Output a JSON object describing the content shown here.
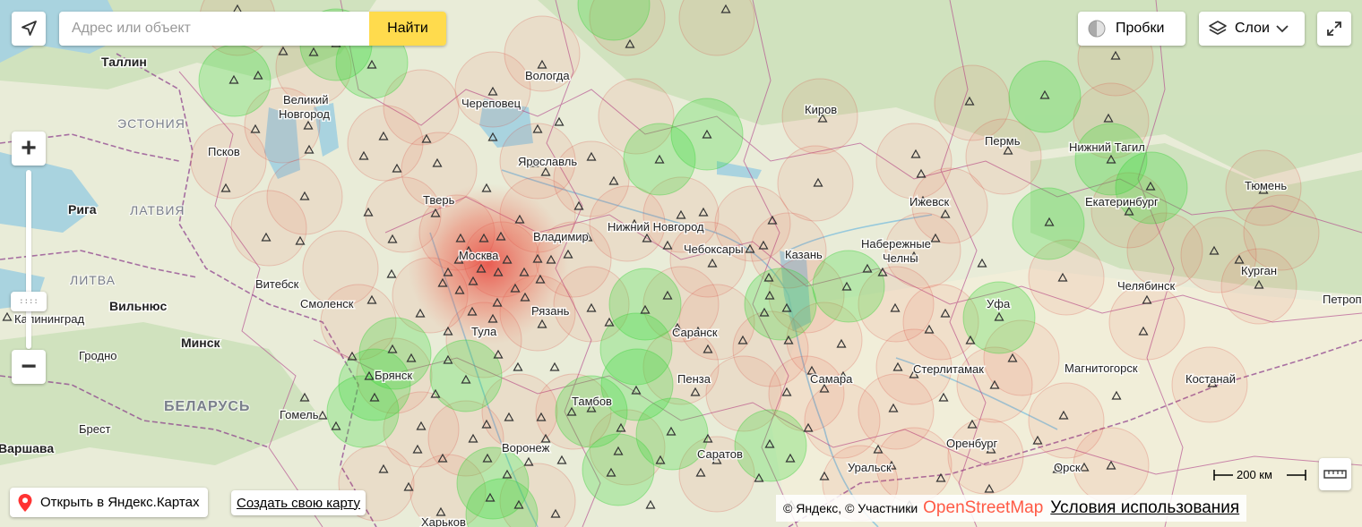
{
  "search": {
    "placeholder": "Адрес или объект",
    "button_label": "Найти"
  },
  "top_right": {
    "traffic_label": "Пробки",
    "layers_label": "Слои"
  },
  "bottom_left": {
    "open_in_maps": "Открыть в Яндекс.Картах",
    "create_map": "Создать свою карту"
  },
  "copyright": {
    "prefix": "© Яндекс, © Участники",
    "osm": "OpenStreetMap",
    "terms": "Условия использования"
  },
  "scale": {
    "label": "200 км"
  },
  "zoom": {
    "plus": "+",
    "minus": "−"
  },
  "colors": {
    "search_button": "#ffdb4d",
    "heat_red": "#e8412e",
    "heat_green": "#3bdc3b",
    "land": "#e9ecd8",
    "water": "#a9d3df",
    "forest": "#c7dfb6",
    "border_purple": "#b34b8e"
  },
  "map": {
    "cities": [
      "Таллин",
      "Великий Новгород",
      "Череповец",
      "Вологда",
      "Псков",
      "Ярославль",
      "Тверь",
      "Москва",
      "Владимир",
      "Нижний Новгород",
      "Чебоксары",
      "Казань",
      "Киров",
      "Пермь",
      "Нижний Тагил",
      "Екатеринбург",
      "Тюмень",
      "Ижевск",
      "Набережные Челны",
      "Рига",
      "Смоленск",
      "Витебск",
      "Вильнюс",
      "Калининград",
      "Минск",
      "Гродно",
      "Брянск",
      "Тула",
      "Рязань",
      "Саранск",
      "Уфа",
      "Челябинск",
      "Курган",
      "Петропавловск",
      "Гомель",
      "Брест",
      "Варшава",
      "Тамбов",
      "Пенза",
      "Самара",
      "Стерлитамак",
      "Магнитогорск",
      "Костанай",
      "Воронеж",
      "Саратов",
      "Оренбург",
      "Орск",
      "Уральск",
      "Харьков"
    ],
    "regions": [
      "ЭСТОНИЯ",
      "ЛАТВИЯ",
      "ЛИТВА",
      "БЕЛАРУСЬ"
    ],
    "city_text": [
      "Таллин",
      "Великий",
      "Новгород",
      "Череповец",
      "Вологда",
      "Псков",
      "Ярославль",
      "Тверь",
      "Москва",
      "Владимир",
      "Нижний Новгород",
      "Чебоксары",
      "Казань",
      "Киров",
      "Пермь",
      "Нижний Тагил",
      "Екатеринбург",
      "Тюмень",
      "Ижевск",
      "Набережные",
      "Челны",
      "Рига",
      "Смоленск",
      "Витебск",
      "Вильнюс",
      "Калининград",
      "Минск",
      "Гродно",
      "Брянск",
      "Тула",
      "Рязань",
      "Саранск",
      "Уфа",
      "Челябинск",
      "Курган",
      "Петропавловск",
      "Гомель",
      "Брест",
      "Варшава",
      "Тамбов",
      "Пенза",
      "Самара",
      "Стерлитамак",
      "Магнитогорск",
      "Костанай",
      "Воронеж",
      "Саратов",
      "Оренбург",
      "Орск",
      "Уральск",
      "Харьков"
    ]
  }
}
